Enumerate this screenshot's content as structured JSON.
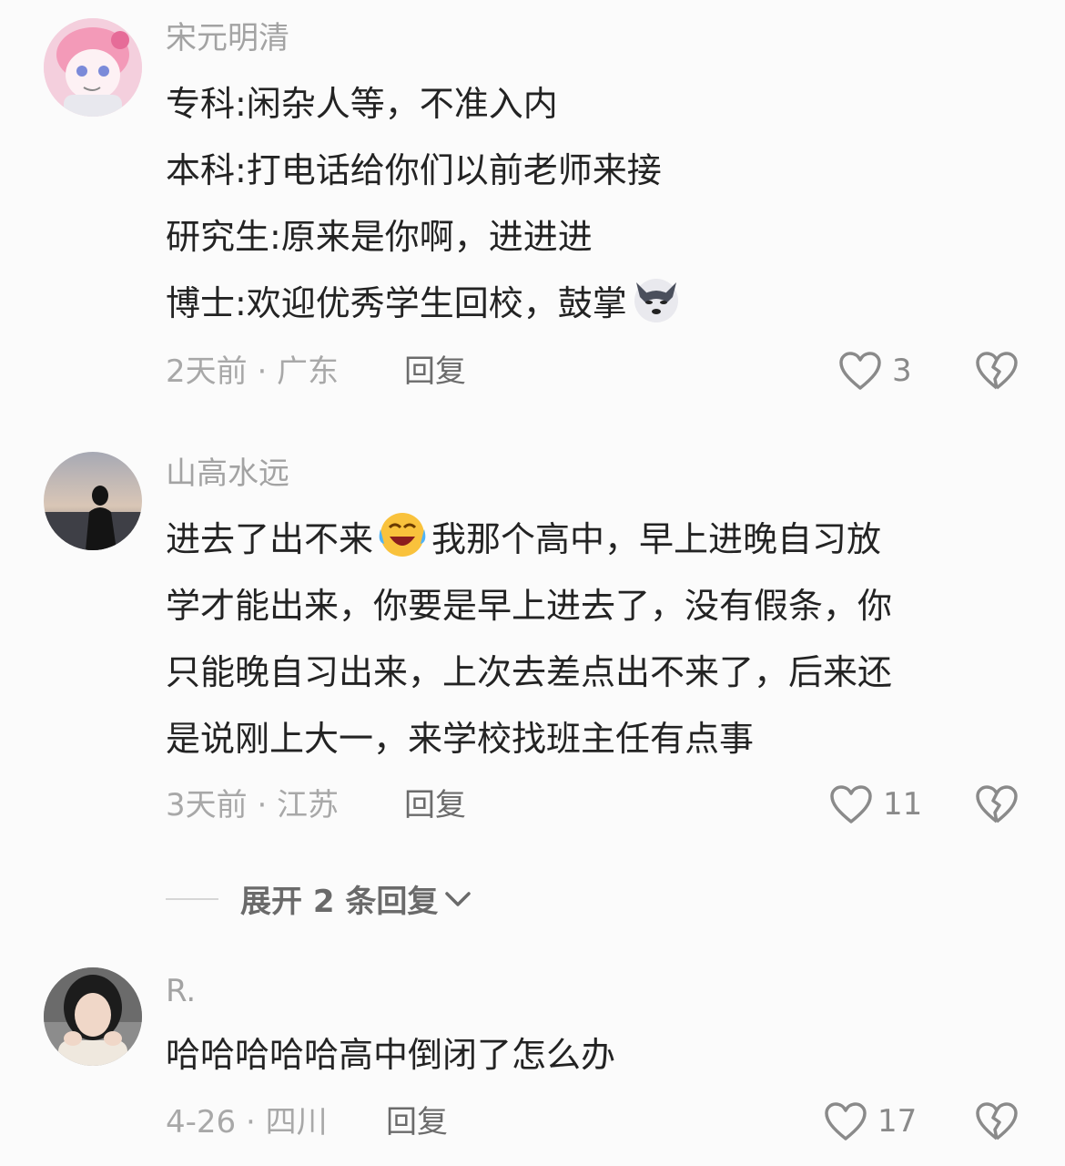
{
  "comments": [
    {
      "username": "宋元明清",
      "lines": [
        "专科:闲杂人等，不准入内",
        "本科:打电话给你们以前老师来接",
        "研究生:原来是你啊，进进进",
        "博士:欢迎优秀学生回校，鼓掌"
      ],
      "emoji": "doge-emoji",
      "time_location": "2天前 · 广东",
      "reply_label": "回复",
      "likes": "3"
    },
    {
      "username": "山高水远",
      "lines_a": "进去了出不来",
      "lines_a_rest": "我那个高中，早上进晚自习放",
      "lines": [
        "学才能出来，你要是早上进去了，没有假条，你",
        "只能晚自习出来，上次去差点出不来了，后来还",
        "是说刚上大一，来学校找班主任有点事"
      ],
      "emoji": "laugh-cry-emoji",
      "time_location": "3天前 · 江苏",
      "reply_label": "回复",
      "likes": "11",
      "expand_label": "展开 2 条回复"
    },
    {
      "username": "R.",
      "lines": [
        "哈哈哈哈哈高中倒闭了怎么办"
      ],
      "time_location": "4-26 · 四川",
      "reply_label": "回复",
      "likes": "17"
    }
  ],
  "colors": {
    "background": "#fbfbfb",
    "username": "#a3a3a3",
    "text": "#232323",
    "meta": "#a8a8a8"
  }
}
